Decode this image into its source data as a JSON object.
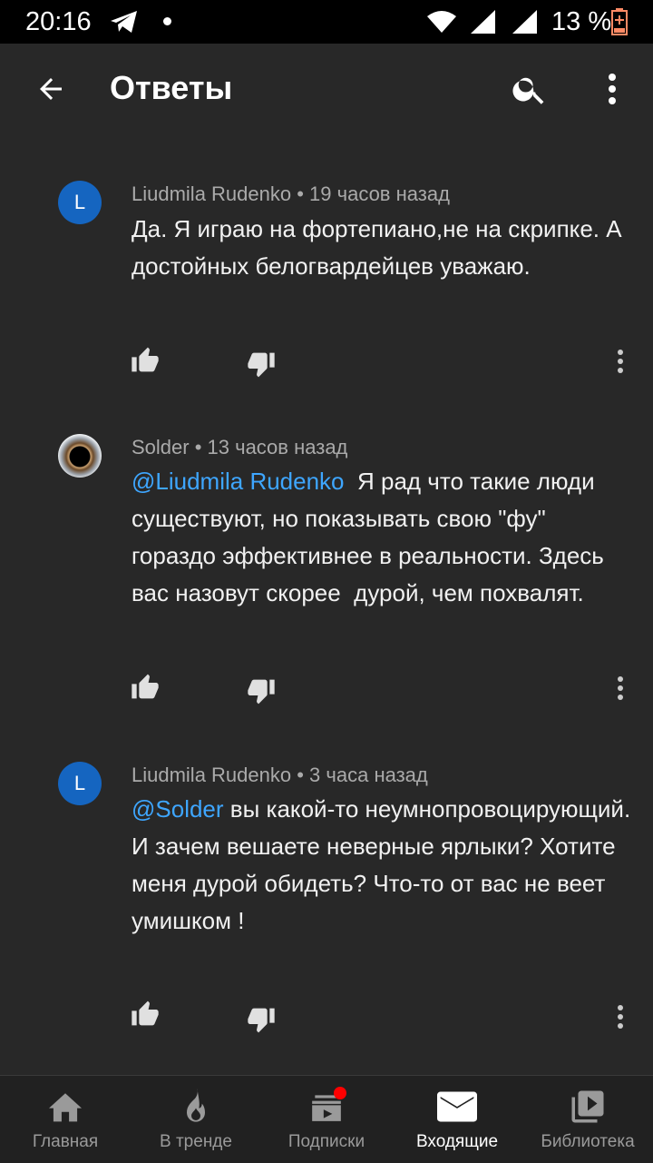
{
  "status_bar": {
    "time": "20:16",
    "battery_text": "13 %",
    "icons": [
      "telegram-icon",
      "notification-dot",
      "wifi-icon",
      "signal-icon",
      "signal-icon",
      "battery-low-icon"
    ]
  },
  "app_bar": {
    "title": "Ответы",
    "back_icon": "arrow-back-icon",
    "search_icon": "search-icon",
    "more_icon": "more-vert-icon"
  },
  "comments": [
    {
      "author": "Liudmila Rudenko",
      "time": "19 часов назад",
      "avatar_letter": "L",
      "mention": "",
      "text": "Да. Я играю на фортепиано,не на скрипке. А достойных  белогвардейцев уважаю."
    },
    {
      "author": "Solder",
      "time": "13 часов назад",
      "avatar_letter": "",
      "mention": "@Liudmila Rudenko",
      "text": "  Я рад что такие люди существуют, но показывать свою \"фу\" гораздо эффективнее в реальности. Здесь вас назовут скорее  дурой, чем похвалят."
    },
    {
      "author": "Liudmila Rudenko",
      "time": "3 часа назад",
      "avatar_letter": "L",
      "mention": "@Solder",
      "text": " вы какой-то неумнопровоцирующий. И зачем вешаете неверные ярлыки? Хотите меня дурой обидеть? Что-то от вас не веет умишком !"
    }
  ],
  "meta_separator": " • ",
  "bottom_nav": {
    "items": [
      {
        "label": "Главная",
        "icon": "home-icon"
      },
      {
        "label": "В тренде",
        "icon": "flame-icon"
      },
      {
        "label": "Подписки",
        "icon": "subscriptions-icon"
      },
      {
        "label": "Входящие",
        "icon": "mail-icon",
        "active": true
      },
      {
        "label": "Библиотека",
        "icon": "library-icon"
      }
    ]
  },
  "colors": {
    "background": "#282828",
    "mention": "#3ea6ff",
    "avatar_blue": "#1565c0",
    "badge_red": "#ff0000"
  }
}
